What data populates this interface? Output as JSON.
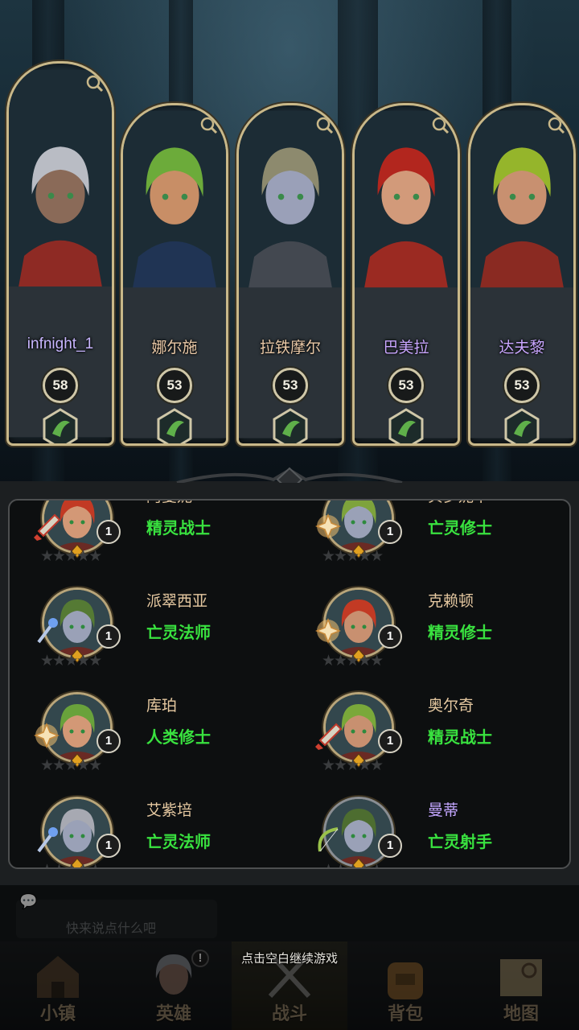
{
  "team": [
    {
      "name": "infnight_1",
      "level": "58",
      "class_icon": "elf-ranger-emblem-icon",
      "hair": "#b9bcc4",
      "skin": "#8a6a58",
      "cloth": "#8e2a24",
      "name_style": "player"
    },
    {
      "name": "娜尔施",
      "level": "53",
      "class_icon": "priest-sun-emblem-icon",
      "hair": "#6cab3a",
      "skin": "#c88e66",
      "cloth": "#203454",
      "name_style": ""
    },
    {
      "name": "拉铁摩尔",
      "level": "53",
      "class_icon": "shield-emblem-icon",
      "hair": "#8d8a6e",
      "skin": "#9aa0b8",
      "cloth": "#434850",
      "name_style": ""
    },
    {
      "name": "巴美拉",
      "level": "53",
      "class_icon": "elf-ranger-emblem-icon",
      "hair": "#b2261e",
      "skin": "#d29a7a",
      "cloth": "#9b2a22",
      "name_style": "purple"
    },
    {
      "name": "达夫黎",
      "level": "53",
      "class_icon": "elf-ranger-emblem-icon",
      "hair": "#95b52b",
      "skin": "#c89070",
      "cloth": "#8a2a22",
      "name_style": "purple"
    }
  ],
  "roster": [
    {
      "name": "阿曼妮",
      "cls": "精灵战士",
      "level": "1",
      "weapon": "sword-icon",
      "hair": "#c23a24",
      "skin": "#d39876",
      "name_style": ""
    },
    {
      "name": "贝罗妮卡",
      "cls": "亡灵修士",
      "level": "1",
      "weapon": "holy-cross-icon",
      "hair": "#7ea33c",
      "skin": "#9aa1b7",
      "name_style": ""
    },
    {
      "name": "派翠西亚",
      "cls": "亡灵法师",
      "level": "1",
      "weapon": "staff-icon",
      "hair": "#557a34",
      "skin": "#9aa1b7",
      "name_style": ""
    },
    {
      "name": "克赖顿",
      "cls": "精灵修士",
      "level": "1",
      "weapon": "holy-cross-icon",
      "hair": "#c23a24",
      "skin": "#c89070",
      "name_style": ""
    },
    {
      "name": "库珀",
      "cls": "人类修士",
      "level": "1",
      "weapon": "holy-cross-icon",
      "hair": "#69a23b",
      "skin": "#d39876",
      "name_style": ""
    },
    {
      "name": "奥尔奇",
      "cls": "精灵战士",
      "level": "1",
      "weapon": "sword-icon",
      "hair": "#7aa83a",
      "skin": "#c89070",
      "name_style": ""
    },
    {
      "name": "艾紫培",
      "cls": "亡灵法师",
      "level": "1",
      "weapon": "staff-icon",
      "hair": "#a7a9b2",
      "skin": "#9aa1b7",
      "name_style": ""
    },
    {
      "name": "曼蒂",
      "cls": "亡灵射手",
      "level": "1",
      "weapon": "bow-icon",
      "hair": "#4d6d30",
      "skin": "#9aa1b7",
      "name_style": "purple"
    }
  ],
  "chat": {
    "placeholder": "快来说点什么吧"
  },
  "continue_hint": "点击空白继续游戏",
  "nav": [
    {
      "label": "小镇",
      "icon": "town-icon"
    },
    {
      "label": "英雄",
      "icon": "hero-portrait-icon",
      "alert": "!"
    },
    {
      "label": "战斗",
      "icon": "crossed-swords-icon"
    },
    {
      "label": "背包",
      "icon": "backpack-icon"
    },
    {
      "label": "地图",
      "icon": "map-scroll-icon"
    }
  ],
  "colors": {
    "frame_gold": "#c9b889",
    "class_green": "#39e23f",
    "name_tan": "#e6c9a1"
  }
}
